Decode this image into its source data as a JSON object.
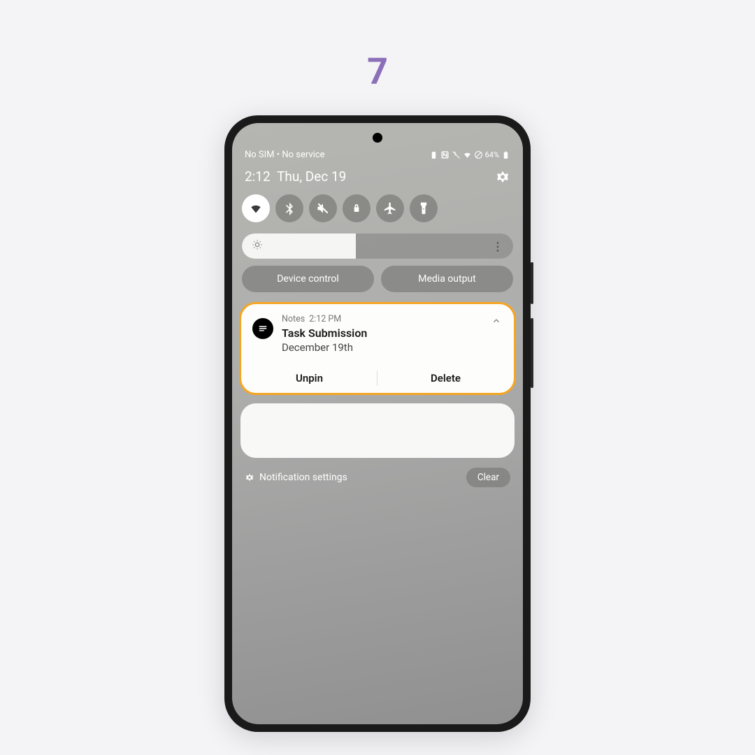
{
  "step_number": "7",
  "status_bar": {
    "left": "No SIM • No service",
    "battery": "64%"
  },
  "time_row": {
    "time": "2:12",
    "date": "Thu, Dec 19"
  },
  "quick_settings": {
    "toggles": [
      {
        "name": "wifi",
        "active": true
      },
      {
        "name": "bluetooth",
        "active": false
      },
      {
        "name": "mute",
        "active": false
      },
      {
        "name": "rotation-lock",
        "active": false
      },
      {
        "name": "airplane",
        "active": false
      },
      {
        "name": "flashlight",
        "active": false
      }
    ]
  },
  "controls": {
    "device_control": "Device control",
    "media_output": "Media output"
  },
  "notification": {
    "app": "Notes",
    "time": "2:12 PM",
    "title": "Task Submission",
    "subtitle": "December 19th",
    "action_unpin": "Unpin",
    "action_delete": "Delete"
  },
  "footer": {
    "settings_label": "Notification settings",
    "clear_label": "Clear"
  }
}
